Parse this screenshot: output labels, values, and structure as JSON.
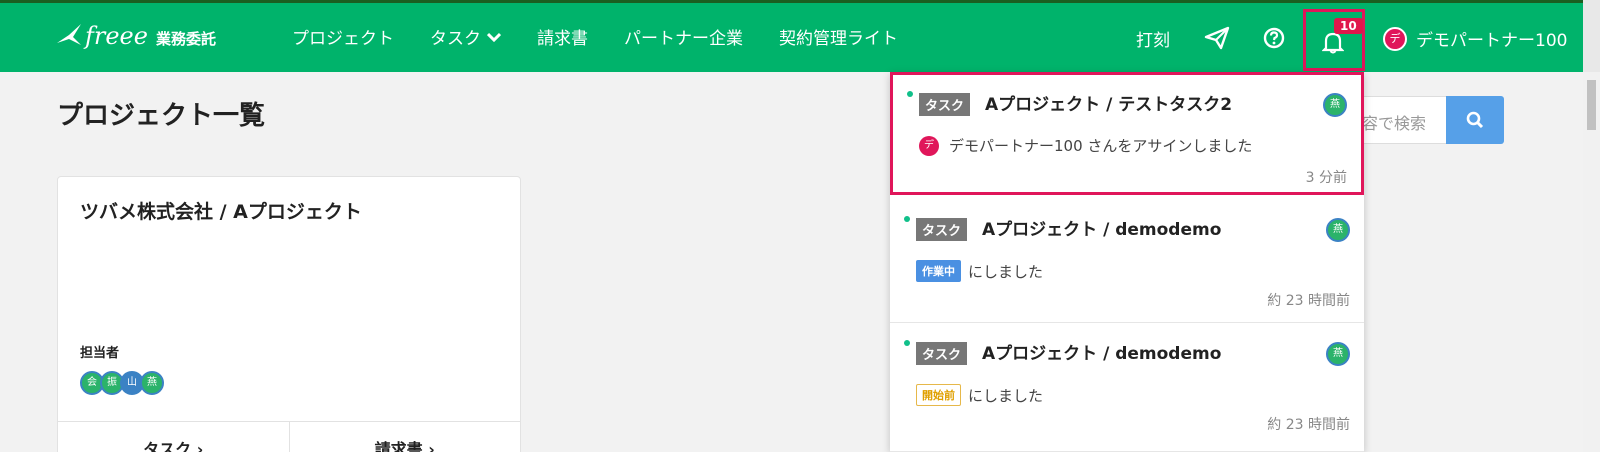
{
  "header": {
    "logo_text": "freee",
    "logo_sub": "業務委託",
    "nav": [
      {
        "label": "プロジェクト"
      },
      {
        "label": "タスク"
      },
      {
        "label": "請求書"
      },
      {
        "label": "パートナー企業"
      },
      {
        "label": "契約管理ライト"
      }
    ],
    "stamp_label": "打刻",
    "notification_count": "10",
    "user_initial": "デ",
    "user_name": "デモパートナー100"
  },
  "page": {
    "title": "プロジェクト一覧",
    "search_placeholder": "内容で検索"
  },
  "card": {
    "title": "ツバメ株式会社 / Aプロジェクト",
    "assignee_label": "担当者",
    "assignees": [
      {
        "initial": "会",
        "color": "#2bb36a"
      },
      {
        "initial": "振",
        "color": "#2bb36a"
      },
      {
        "initial": "山",
        "color": "#3b82c4"
      },
      {
        "initial": "燕",
        "color": "#2bb36a"
      }
    ],
    "task_button": "タスク",
    "invoice_button": "請求書"
  },
  "notifications": [
    {
      "tag": "タスク",
      "title": "Aプロジェクト / テストタスク2",
      "avatar": "燕",
      "actor_initial": "デ",
      "message": "デモパートナー100 さんをアサインしました",
      "time": "3 分前"
    },
    {
      "tag": "タスク",
      "title": "Aプロジェクト / demodemo",
      "avatar": "燕",
      "status": "作業中",
      "message": "にしました",
      "time": "約 23 時間前"
    },
    {
      "tag": "タスク",
      "title": "Aプロジェクト / demodemo",
      "avatar": "燕",
      "status": "開始前",
      "message": "にしました",
      "time": "約 23 時間前"
    }
  ]
}
